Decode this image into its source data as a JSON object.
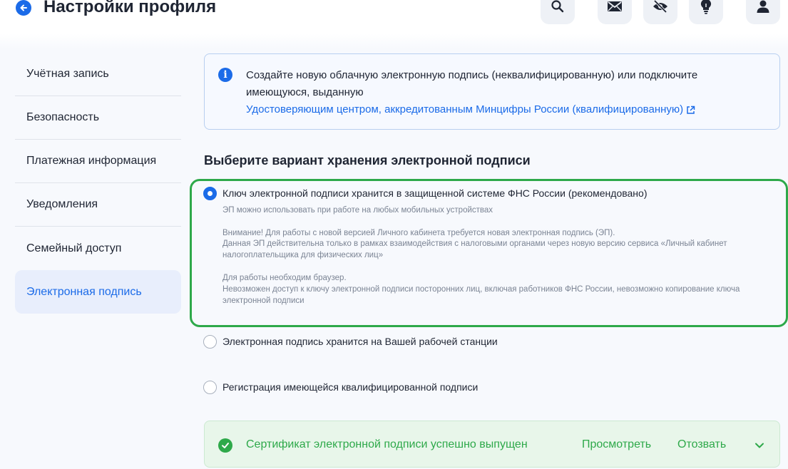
{
  "header": {
    "title": "Настройки профиля",
    "icons": [
      "search-icon",
      "mail-icon",
      "eye-off-icon",
      "lightbulb-icon",
      "user-icon"
    ]
  },
  "sidebar": {
    "items": [
      {
        "label": "Учётная запись"
      },
      {
        "label": "Безопасность"
      },
      {
        "label": "Платежная информация"
      },
      {
        "label": "Уведомления"
      },
      {
        "label": "Семейный доступ"
      },
      {
        "label": "Электронная подпись",
        "active": true
      }
    ]
  },
  "info": {
    "text": "Создайте новую облачную электронную подпись (неквалифицированную) или подключите имеющуюся, выданную",
    "link": "Удостоверяющим центром, аккредитованным Минцифры России (квалифицированную)"
  },
  "section": {
    "title": "Выберите вариант хранения электронной подписи"
  },
  "options": [
    {
      "label": "Ключ электронной подписи хранится в защищенной системе ФНС России (рекомендовано)",
      "selected": true,
      "desc1": "ЭП можно использовать при работе на любых мобильных устройствах",
      "desc2a": "Внимание! Для работы с новой версией Личного кабинета требуется новая электронная подпись (ЭП).",
      "desc2b": "Данная ЭП действительна только в рамках взаимодействия с налоговыми органами через новую версию сервиса «Личный кабинет налогоплательщика для физических лиц»",
      "desc3a": "Для работы необходим браузер.",
      "desc3b": "Невозможен доступ к ключу электронной подписи посторонних лиц, включая работников ФНС России, невозможно копирование ключа электронной подписи"
    },
    {
      "label": "Электронная подпись хранится на Вашей рабочей станции",
      "selected": false
    },
    {
      "label": "Регистрация имеющейся квалифицированной подписи",
      "selected": false
    }
  ],
  "status": {
    "text": "Сертификат электронной подписи успешно выпущен",
    "view": "Просмотреть",
    "revoke": "Отозвать"
  },
  "colors": {
    "accent": "#1b6be8",
    "success": "#2ea94a"
  }
}
